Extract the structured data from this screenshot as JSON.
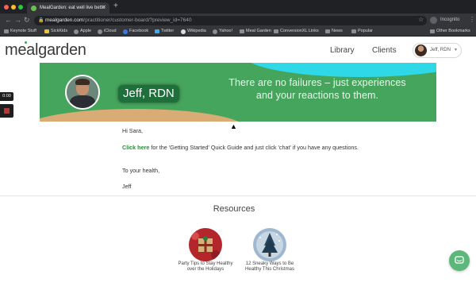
{
  "browser": {
    "tab_title": "MealGarden: eat well live bette",
    "url_domain": "mealgarden.com",
    "url_path": "/practitioner/customer-board/?preview_id=7640",
    "incognito_label": "Incognito",
    "bookmarks": [
      "Keynote Stuff",
      "SickKids",
      "Apple",
      "iCloud",
      "Facebook",
      "Twitter",
      "Wikipedia",
      "Yahoo!",
      "Meal Garden",
      "ConversionXL Links",
      "News",
      "Popular"
    ],
    "other_bookmarks": "Other Bookmarks"
  },
  "header": {
    "logo": "mealgarden",
    "nav": [
      "Library",
      "Clients"
    ],
    "user_name": "Jeff, RDN"
  },
  "video_widget": {
    "timer": "0:00"
  },
  "banner": {
    "name": "Jeff, RDN",
    "quote_line1": "There are no failures – just experiences",
    "quote_line2": "and your reactions to them."
  },
  "message": {
    "greeting": "Hi Sara,",
    "link_text": "Click here",
    "body": " for the 'Getting Started' Quick Guide and just click 'chat' if you have any questions.",
    "closing": "To your health,",
    "signature": "Jeff"
  },
  "resources": {
    "title": "Resources",
    "items": [
      {
        "caption": "Party Tips to Stay Healthy over the Holidays"
      },
      {
        "caption": "12 Sneaky Ways to Be Healthy This Christmas"
      }
    ]
  },
  "colors": {
    "brand_green": "#46a55c",
    "link_green": "#2e8b3e",
    "banner_cyan": "#2ed8e6",
    "banner_tan": "#d8ac74",
    "chat_green": "#5cb87a"
  }
}
